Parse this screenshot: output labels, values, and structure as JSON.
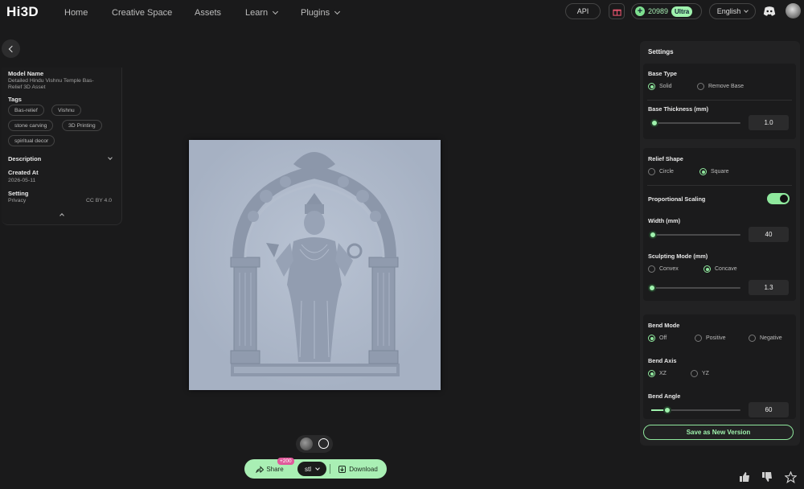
{
  "nav": {
    "logo": "Hi3D",
    "items": [
      {
        "label": "Home"
      },
      {
        "label": "Creative Space"
      },
      {
        "label": "Assets"
      },
      {
        "label": "Learn"
      },
      {
        "label": "Plugins"
      }
    ],
    "api_label": "API",
    "credits": "20989",
    "plan": "Ultra",
    "language": "English"
  },
  "info": {
    "model_name_label": "Model Name",
    "model_name_line1": "Detailed Hindu Vishnu Temple Bas-",
    "model_name_line2": "Relief 3D Asset",
    "tags_label": "Tags",
    "tags": [
      "Bas-relief",
      "Vishnu",
      "stone carving",
      "3D Printing",
      "spiritual decor"
    ],
    "description_label": "Description",
    "created_label": "Created At",
    "created_value": "2026-05-11",
    "setting_label": "Setting",
    "privacy_label": "Privacy",
    "privacy_value": "CC BY 4.0"
  },
  "actions": {
    "share_label": "Share",
    "share_badge": "+200",
    "format": "stl",
    "download_label": "Download"
  },
  "settings": {
    "title": "Settings",
    "base_type": {
      "label": "Base Type",
      "options": [
        "Solid",
        "Remove Base"
      ],
      "selected": "Solid"
    },
    "base_thickness": {
      "label": "Base Thickness (mm)",
      "value": "1.0",
      "level": 0.03
    },
    "relief_shape": {
      "label": "Relief Shape",
      "options": [
        "Circle",
        "Square"
      ],
      "selected": "Square"
    },
    "proportional_scaling": {
      "label": "Proportional Scaling",
      "on": true
    },
    "width": {
      "label": "Width (mm)",
      "value": "40",
      "level": 0.01
    },
    "sculpting_mode": {
      "label": "Sculpting Mode (mm)",
      "options": [
        "Convex",
        "Concave"
      ],
      "selected": "Concave",
      "value": "1.3",
      "level": 0.0
    },
    "bend_mode": {
      "label": "Bend Mode",
      "options": [
        "Off",
        "Positive",
        "Negative"
      ],
      "selected": "Off"
    },
    "bend_axis": {
      "label": "Bend Axis",
      "options": [
        "XZ",
        "YZ"
      ],
      "selected": "XZ"
    },
    "bend_angle": {
      "label": "Bend Angle",
      "value": "60",
      "level": 0.17
    },
    "save_label": "Save as New Version"
  },
  "colors": {
    "accent": "#9ff2ad",
    "background": "#1a1a1b",
    "model": "#a9b4c6"
  }
}
